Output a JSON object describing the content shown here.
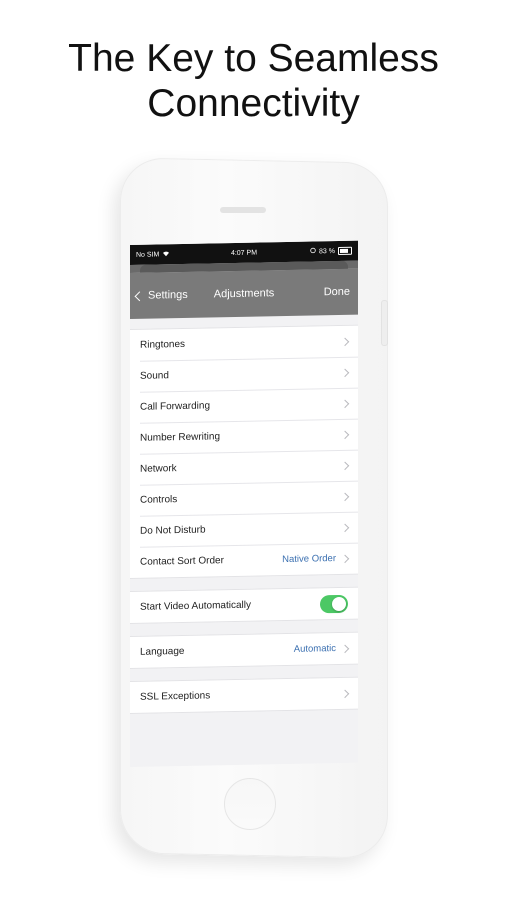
{
  "headline": {
    "line1": "The Key to Seamless",
    "line2": "Connectivity"
  },
  "status_bar": {
    "carrier": "No SIM",
    "time": "4:07 PM",
    "battery": "83 %"
  },
  "nav": {
    "back_label": "Settings",
    "title": "Adjustments",
    "done_label": "Done"
  },
  "groups": {
    "main": [
      {
        "label": "Ringtones"
      },
      {
        "label": "Sound"
      },
      {
        "label": "Call Forwarding"
      },
      {
        "label": "Number Rewriting"
      },
      {
        "label": "Network"
      },
      {
        "label": "Controls"
      },
      {
        "label": "Do Not Disturb"
      },
      {
        "label": "Contact Sort Order",
        "value": "Native Order"
      }
    ],
    "video": {
      "label": "Start Video Automatically",
      "enabled": true
    },
    "language": {
      "label": "Language",
      "value": "Automatic"
    },
    "ssl": {
      "label": "SSL Exceptions"
    }
  },
  "colors": {
    "toggle_on": "#4cc865",
    "value_text": "#3a6fb0",
    "nav_bar": "#7a7a7a"
  }
}
